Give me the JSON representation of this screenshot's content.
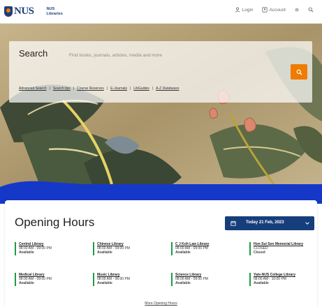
{
  "header": {
    "logo_text": "NUS",
    "library_name": [
      "NUS",
      "Libraries"
    ],
    "actions": [
      {
        "label": "Login"
      },
      {
        "label": "Account"
      }
    ]
  },
  "search": {
    "title": "Search",
    "placeholder": "Find books, journals, articles, media and more",
    "links": [
      "Advanced Search",
      "Search tips",
      "Course Reserves",
      "E-Journals",
      "LibGuides",
      "A-Z Databases"
    ],
    "separator": "|"
  },
  "hours": {
    "title": "Opening Hours",
    "date_label": "Today 21 Feb, 2023",
    "libraries": [
      {
        "name": "Central Library",
        "hours": "08:00 AM - 09:00 PM",
        "extra": "",
        "status": "Available"
      },
      {
        "name": "Chinese Library",
        "hours": "08:00 AM - 09:00 PM",
        "extra": "",
        "status": "Available"
      },
      {
        "name": "C J Koh Law Library",
        "hours": "08:00 AM - 09:00 PM",
        "extra": "",
        "status": "Available"
      },
      {
        "name": "Hon Sui Sen Memorial Library",
        "hours": "CLOSED",
        "extra": "",
        "status": "Closed"
      },
      {
        "name": "Medical Library",
        "hours": "08:00 AM - 09:00 PM",
        "extra": "",
        "status": "Available"
      },
      {
        "name": "Music Library",
        "hours": "08:00 AM - 06:00 PM",
        "extra": "",
        "status": "Available"
      },
      {
        "name": "Science Library",
        "hours": "08:00 AM - 09:00 PM",
        "extra": "",
        "status": "Available"
      },
      {
        "name": "Yale-NUS College Library",
        "hours": "08:00 AM - 10:00 PM",
        "extra": "",
        "status": "Available"
      }
    ],
    "more_link": "More Opening Hours"
  },
  "colors": {
    "accent": "#ef7c00",
    "brand_blue": "#163e7c",
    "band_blue": "#1638c9",
    "status_green": "#1e9a47"
  },
  "icons": {
    "login": "user-icon",
    "account": "person-icon",
    "settings": "gear-icon",
    "search": "search-icon",
    "calendar": "calendar-icon",
    "dropdown": "chevron-down-icon"
  }
}
